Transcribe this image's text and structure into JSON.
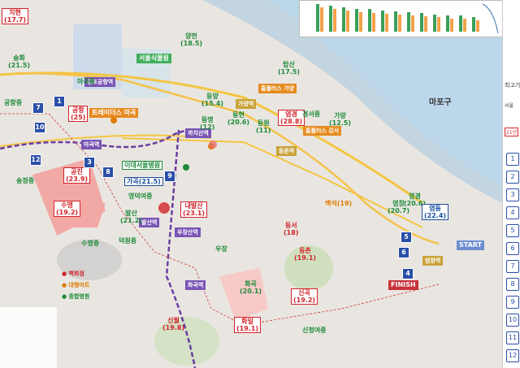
{
  "district_label": "마포구",
  "park_label": "서울식물원",
  "route": {
    "start": "START",
    "finish": "FINISH"
  },
  "stations": [
    "마곡역",
    "발산역",
    "우장산역",
    "화곡역",
    "가양역",
    "등촌역",
    "염창역",
    "까치산역",
    "김포공항역"
  ],
  "schools": [
    {
      "name": "치현",
      "value": "17.7",
      "color": "red"
    },
    {
      "name": "송화",
      "value": "21.5",
      "color": "green"
    },
    {
      "name": "공항중",
      "value": "",
      "color": "green"
    },
    {
      "name": "공항",
      "value": "25",
      "color": "red"
    },
    {
      "name": "마곡중",
      "value": "",
      "color": "green"
    },
    {
      "name": "송정중",
      "value": "",
      "color": "green"
    },
    {
      "name": "공진",
      "value": "23.9",
      "color": "red"
    },
    {
      "name": "수명",
      "value": "19.2",
      "color": "red"
    },
    {
      "name": "수명중",
      "value": "",
      "color": "green"
    },
    {
      "name": "가곡",
      "value": "21.5",
      "color": "blue"
    },
    {
      "name": "영덕여중",
      "value": "",
      "color": "green"
    },
    {
      "name": "발산",
      "value": "21.2",
      "color": "green"
    },
    {
      "name": "덕원중",
      "value": "",
      "color": "green"
    },
    {
      "name": "내발산",
      "value": "23.1",
      "color": "red"
    },
    {
      "name": "양천",
      "value": "18.5",
      "color": "green"
    },
    {
      "name": "등양",
      "value": "15.4",
      "color": "green"
    },
    {
      "name": "등명",
      "value": "12",
      "color": "green"
    },
    {
      "name": "등현",
      "value": "20.6",
      "color": "green"
    },
    {
      "name": "등원",
      "value": "11",
      "color": "green"
    },
    {
      "name": "염경",
      "value": "28.8",
      "color": "red"
    },
    {
      "name": "탑산",
      "value": "17.5",
      "color": "green"
    },
    {
      "name": "경서중",
      "value": "",
      "color": "green"
    },
    {
      "name": "가양",
      "value": "12.5",
      "color": "green"
    },
    {
      "name": "염경",
      "value": "20.6",
      "color": "green"
    },
    {
      "name": "염창",
      "value": "20.7",
      "color": "green"
    },
    {
      "name": "염동",
      "value": "22.4",
      "color": "blue"
    },
    {
      "name": "등서",
      "value": "18",
      "color": "red"
    },
    {
      "name": "등촌",
      "value": "19.1",
      "color": "red"
    },
    {
      "name": "백석",
      "value": "19",
      "color": "orange"
    },
    {
      "name": "우장",
      "value": "",
      "color": "green"
    },
    {
      "name": "화곡",
      "value": "20.1",
      "color": "green"
    },
    {
      "name": "화일",
      "value": "19.1",
      "color": "red"
    },
    {
      "name": "신곡",
      "value": "19.2",
      "color": "red"
    },
    {
      "name": "신월",
      "value": "19.8",
      "color": "red"
    },
    {
      "name": "신정여중",
      "value": "",
      "color": "green"
    }
  ],
  "facilities": [
    "이대서울병원",
    "트레이더스 마곡",
    "홈플러스 가양",
    "홈플러스 강서"
  ],
  "legend": [
    "백화점",
    "대형마트",
    "종합병원"
  ],
  "panel_text": [
    "최고기",
    "서울",
    "21년"
  ],
  "colors": {
    "road": "#f4b400",
    "metro": "#6a3ea1",
    "route": "#f5c24b",
    "water": "#b6d3e8"
  }
}
